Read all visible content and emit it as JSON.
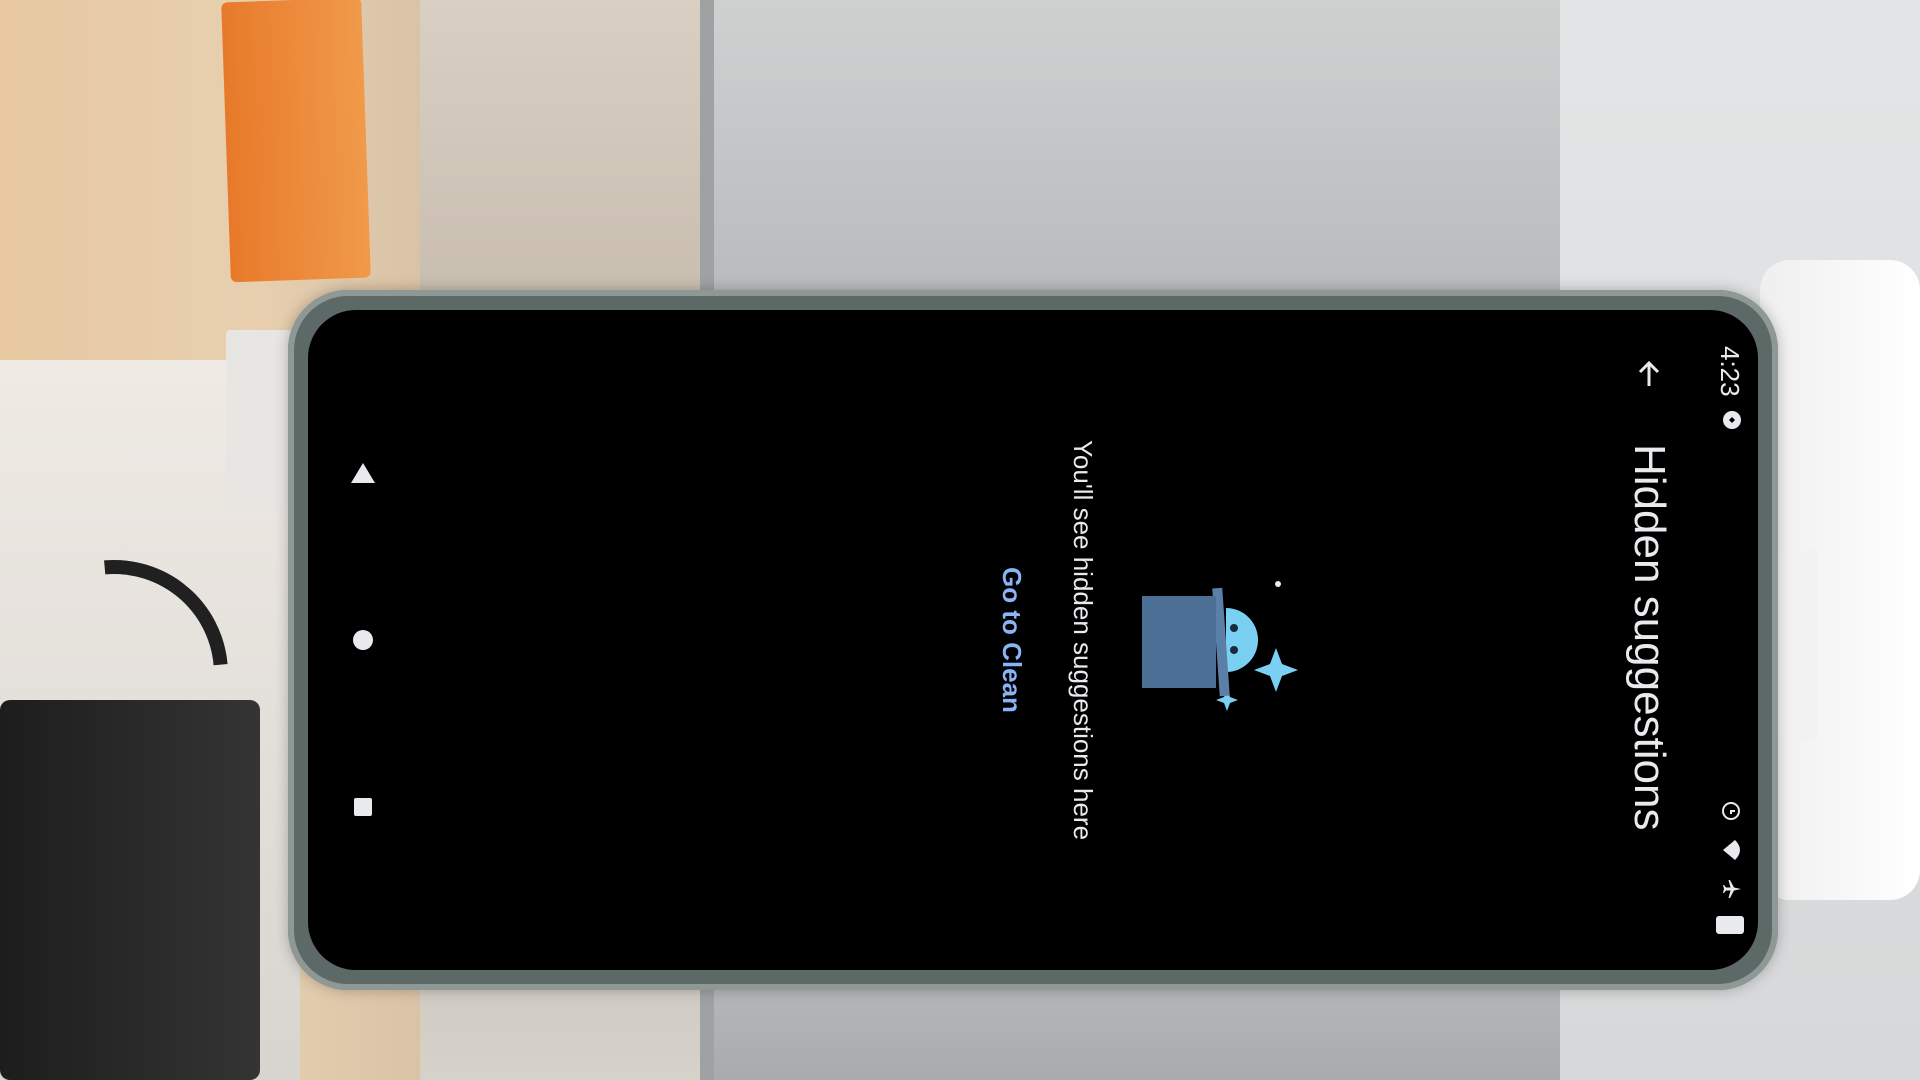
{
  "status_bar": {
    "time": "4:23",
    "left_icons": [
      "notification-dot-icon"
    ],
    "right_icons": [
      "alarm-icon",
      "wifi-icon",
      "airplane-icon",
      "battery-icon"
    ]
  },
  "app_bar": {
    "back_icon": "arrow-back-icon",
    "title": "Hidden suggestions"
  },
  "empty_state": {
    "illustration": "bin-with-sparkles-illustration",
    "message": "You'll see hidden suggestions here",
    "action_label": "Go to Clean"
  },
  "nav_bar": {
    "buttons": [
      "nav-back-icon",
      "nav-home-icon",
      "nav-recents-icon"
    ]
  },
  "colors": {
    "background": "#000000",
    "text": "#e8eaed",
    "accent": "#8ab4f8",
    "illustration_primary": "#4b6f95",
    "illustration_secondary": "#7ad0f2"
  }
}
